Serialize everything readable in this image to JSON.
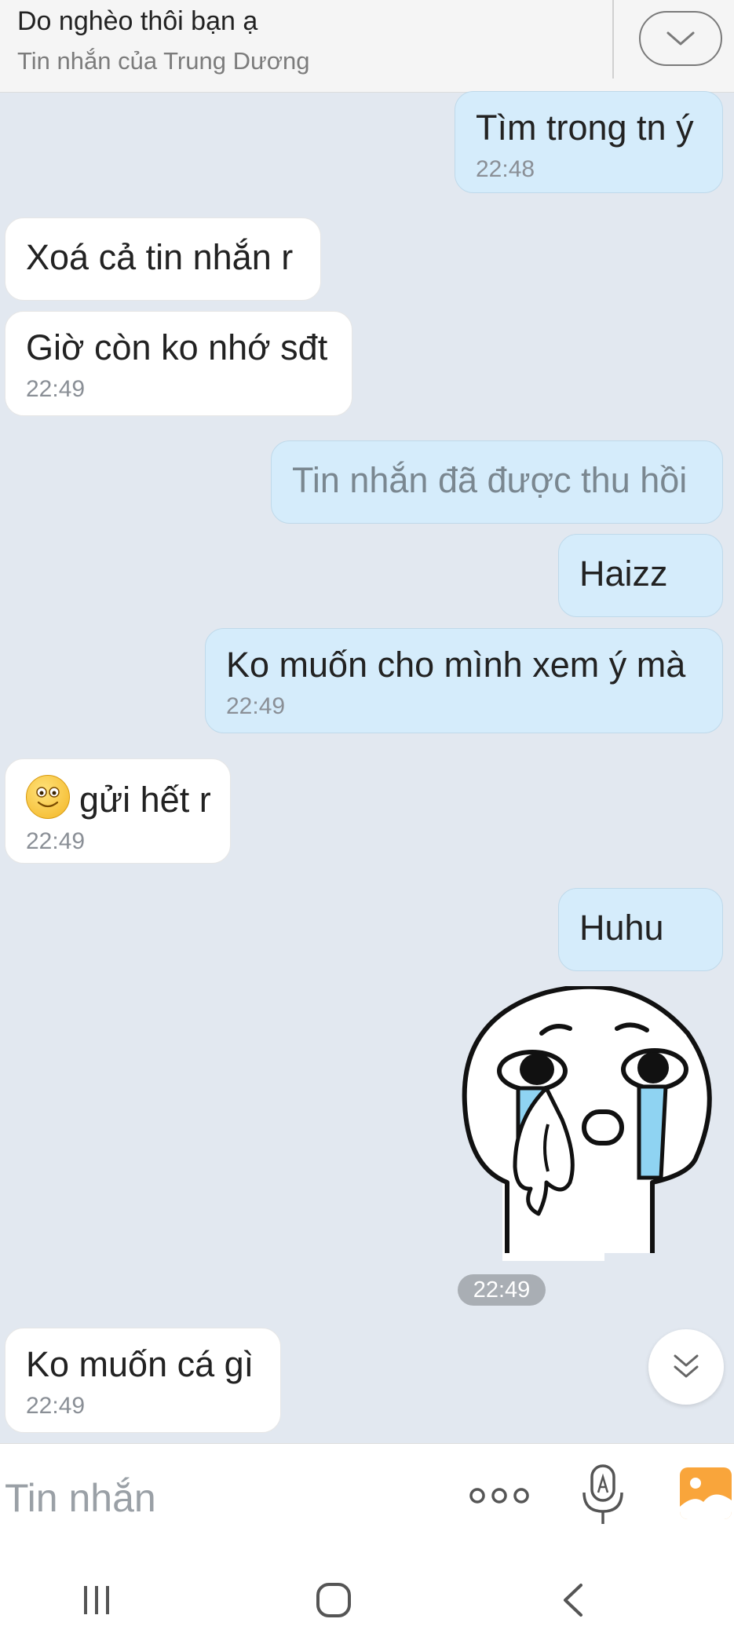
{
  "header": {
    "title": "Do nghèo thôi bạn ạ",
    "subtitle": "Tin nhắn của Trung Dương"
  },
  "messages": [
    {
      "side": "out",
      "text": "Tìm trong tn ý",
      "time": "22:48"
    },
    {
      "side": "in",
      "text": "Xoá cả tin nhắn r"
    },
    {
      "side": "in",
      "text": "Giờ còn ko nhớ sđt",
      "time": "22:49"
    },
    {
      "side": "out",
      "text": "Tin nhắn đã được thu hồi",
      "recalled": true
    },
    {
      "side": "out",
      "text": "Haizz"
    },
    {
      "side": "out",
      "text": "Ko muốn cho mình xem ý mà",
      "time": "22:49"
    },
    {
      "side": "in",
      "emoji": "smiley-emoji",
      "text": "gửi hết r",
      "time": "22:49"
    },
    {
      "side": "out",
      "text": "Huhu"
    },
    {
      "side": "out",
      "sticker": "crying-sticker",
      "time": "22:49"
    },
    {
      "side": "in",
      "text": "Ko muốn cá gì",
      "time": "22:49"
    }
  ],
  "composer": {
    "placeholder": "Tin nhắn",
    "icons": [
      "more-options-icon",
      "voice-to-text-icon",
      "image-picker-icon"
    ]
  },
  "navbar": {
    "icons": [
      "recent-apps-icon",
      "home-icon",
      "back-icon"
    ]
  },
  "colors": {
    "background": "#e2e8f0",
    "outgoing_bubble": "#d5ecfb",
    "incoming_bubble": "#ffffff",
    "accent_image_button": "#f9a53b"
  }
}
